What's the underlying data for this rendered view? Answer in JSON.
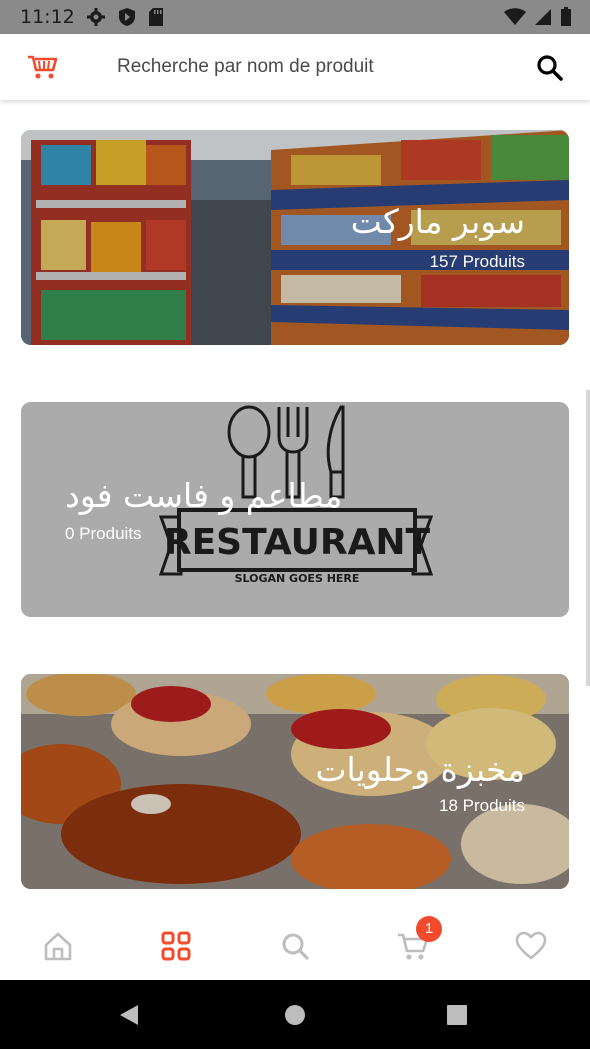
{
  "status_bar": {
    "time": "11:12",
    "left_icons": [
      "settings-icon",
      "shield-icon",
      "sd-card-icon"
    ],
    "right_icons": [
      "wifi-icon",
      "signal-icon",
      "battery-icon"
    ]
  },
  "header": {
    "logo_icon": "shopping-cart-logo-icon",
    "search_placeholder": "Recherche par nom de produit",
    "search_icon": "search-icon"
  },
  "categories": [
    {
      "title": "سوبر ماركت",
      "count": "157 Produits",
      "image": "supermarket-shelves"
    },
    {
      "title": "مطاعم و فاست فود",
      "count": "0 Produits",
      "image": "restaurant-logo",
      "logo_text": "RESTAURANT",
      "logo_slogan": "SLOGAN GOES HERE"
    },
    {
      "title": "مخبزة وحلويات",
      "count": "18 Produits",
      "image": "pastries"
    }
  ],
  "bottom_nav": {
    "items": [
      {
        "icon": "home-icon",
        "active": false
      },
      {
        "icon": "grid-icon",
        "active": true
      },
      {
        "icon": "search-icon",
        "active": false
      },
      {
        "icon": "cart-icon",
        "active": false,
        "badge": "1"
      },
      {
        "icon": "heart-icon",
        "active": false
      }
    ]
  },
  "colors": {
    "accent": "#f24a2d",
    "inactive_icon": "#bdbdbd",
    "status_bar": "#8a8a8a"
  }
}
